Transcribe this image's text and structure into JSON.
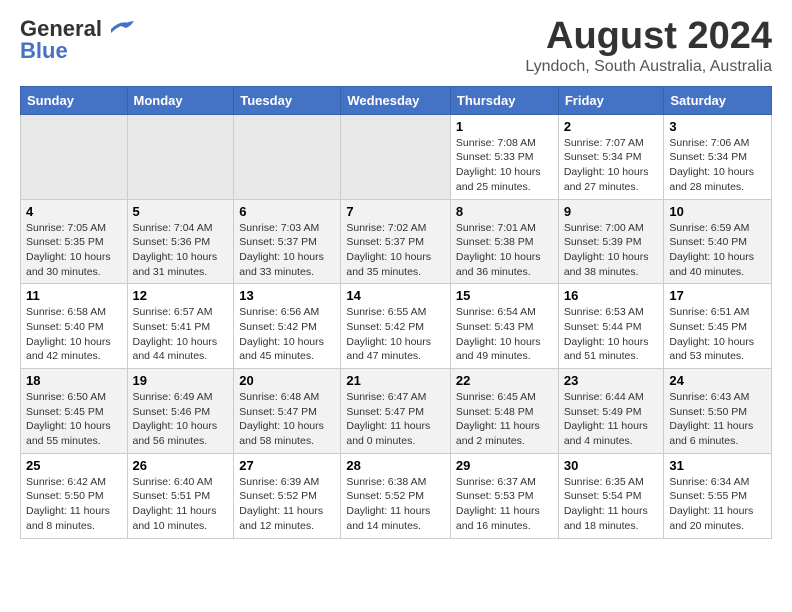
{
  "header": {
    "logo_general": "General",
    "logo_blue": "Blue",
    "title": "August 2024",
    "subtitle": "Lyndoch, South Australia, Australia"
  },
  "weekdays": [
    "Sunday",
    "Monday",
    "Tuesday",
    "Wednesday",
    "Thursday",
    "Friday",
    "Saturday"
  ],
  "weeks": [
    [
      {
        "day": "",
        "info": ""
      },
      {
        "day": "",
        "info": ""
      },
      {
        "day": "",
        "info": ""
      },
      {
        "day": "",
        "info": ""
      },
      {
        "day": "1",
        "info": "Sunrise: 7:08 AM\nSunset: 5:33 PM\nDaylight: 10 hours\nand 25 minutes."
      },
      {
        "day": "2",
        "info": "Sunrise: 7:07 AM\nSunset: 5:34 PM\nDaylight: 10 hours\nand 27 minutes."
      },
      {
        "day": "3",
        "info": "Sunrise: 7:06 AM\nSunset: 5:34 PM\nDaylight: 10 hours\nand 28 minutes."
      }
    ],
    [
      {
        "day": "4",
        "info": "Sunrise: 7:05 AM\nSunset: 5:35 PM\nDaylight: 10 hours\nand 30 minutes."
      },
      {
        "day": "5",
        "info": "Sunrise: 7:04 AM\nSunset: 5:36 PM\nDaylight: 10 hours\nand 31 minutes."
      },
      {
        "day": "6",
        "info": "Sunrise: 7:03 AM\nSunset: 5:37 PM\nDaylight: 10 hours\nand 33 minutes."
      },
      {
        "day": "7",
        "info": "Sunrise: 7:02 AM\nSunset: 5:37 PM\nDaylight: 10 hours\nand 35 minutes."
      },
      {
        "day": "8",
        "info": "Sunrise: 7:01 AM\nSunset: 5:38 PM\nDaylight: 10 hours\nand 36 minutes."
      },
      {
        "day": "9",
        "info": "Sunrise: 7:00 AM\nSunset: 5:39 PM\nDaylight: 10 hours\nand 38 minutes."
      },
      {
        "day": "10",
        "info": "Sunrise: 6:59 AM\nSunset: 5:40 PM\nDaylight: 10 hours\nand 40 minutes."
      }
    ],
    [
      {
        "day": "11",
        "info": "Sunrise: 6:58 AM\nSunset: 5:40 PM\nDaylight: 10 hours\nand 42 minutes."
      },
      {
        "day": "12",
        "info": "Sunrise: 6:57 AM\nSunset: 5:41 PM\nDaylight: 10 hours\nand 44 minutes."
      },
      {
        "day": "13",
        "info": "Sunrise: 6:56 AM\nSunset: 5:42 PM\nDaylight: 10 hours\nand 45 minutes."
      },
      {
        "day": "14",
        "info": "Sunrise: 6:55 AM\nSunset: 5:42 PM\nDaylight: 10 hours\nand 47 minutes."
      },
      {
        "day": "15",
        "info": "Sunrise: 6:54 AM\nSunset: 5:43 PM\nDaylight: 10 hours\nand 49 minutes."
      },
      {
        "day": "16",
        "info": "Sunrise: 6:53 AM\nSunset: 5:44 PM\nDaylight: 10 hours\nand 51 minutes."
      },
      {
        "day": "17",
        "info": "Sunrise: 6:51 AM\nSunset: 5:45 PM\nDaylight: 10 hours\nand 53 minutes."
      }
    ],
    [
      {
        "day": "18",
        "info": "Sunrise: 6:50 AM\nSunset: 5:45 PM\nDaylight: 10 hours\nand 55 minutes."
      },
      {
        "day": "19",
        "info": "Sunrise: 6:49 AM\nSunset: 5:46 PM\nDaylight: 10 hours\nand 56 minutes."
      },
      {
        "day": "20",
        "info": "Sunrise: 6:48 AM\nSunset: 5:47 PM\nDaylight: 10 hours\nand 58 minutes."
      },
      {
        "day": "21",
        "info": "Sunrise: 6:47 AM\nSunset: 5:47 PM\nDaylight: 11 hours\nand 0 minutes."
      },
      {
        "day": "22",
        "info": "Sunrise: 6:45 AM\nSunset: 5:48 PM\nDaylight: 11 hours\nand 2 minutes."
      },
      {
        "day": "23",
        "info": "Sunrise: 6:44 AM\nSunset: 5:49 PM\nDaylight: 11 hours\nand 4 minutes."
      },
      {
        "day": "24",
        "info": "Sunrise: 6:43 AM\nSunset: 5:50 PM\nDaylight: 11 hours\nand 6 minutes."
      }
    ],
    [
      {
        "day": "25",
        "info": "Sunrise: 6:42 AM\nSunset: 5:50 PM\nDaylight: 11 hours\nand 8 minutes."
      },
      {
        "day": "26",
        "info": "Sunrise: 6:40 AM\nSunset: 5:51 PM\nDaylight: 11 hours\nand 10 minutes."
      },
      {
        "day": "27",
        "info": "Sunrise: 6:39 AM\nSunset: 5:52 PM\nDaylight: 11 hours\nand 12 minutes."
      },
      {
        "day": "28",
        "info": "Sunrise: 6:38 AM\nSunset: 5:52 PM\nDaylight: 11 hours\nand 14 minutes."
      },
      {
        "day": "29",
        "info": "Sunrise: 6:37 AM\nSunset: 5:53 PM\nDaylight: 11 hours\nand 16 minutes."
      },
      {
        "day": "30",
        "info": "Sunrise: 6:35 AM\nSunset: 5:54 PM\nDaylight: 11 hours\nand 18 minutes."
      },
      {
        "day": "31",
        "info": "Sunrise: 6:34 AM\nSunset: 5:55 PM\nDaylight: 11 hours\nand 20 minutes."
      }
    ]
  ]
}
